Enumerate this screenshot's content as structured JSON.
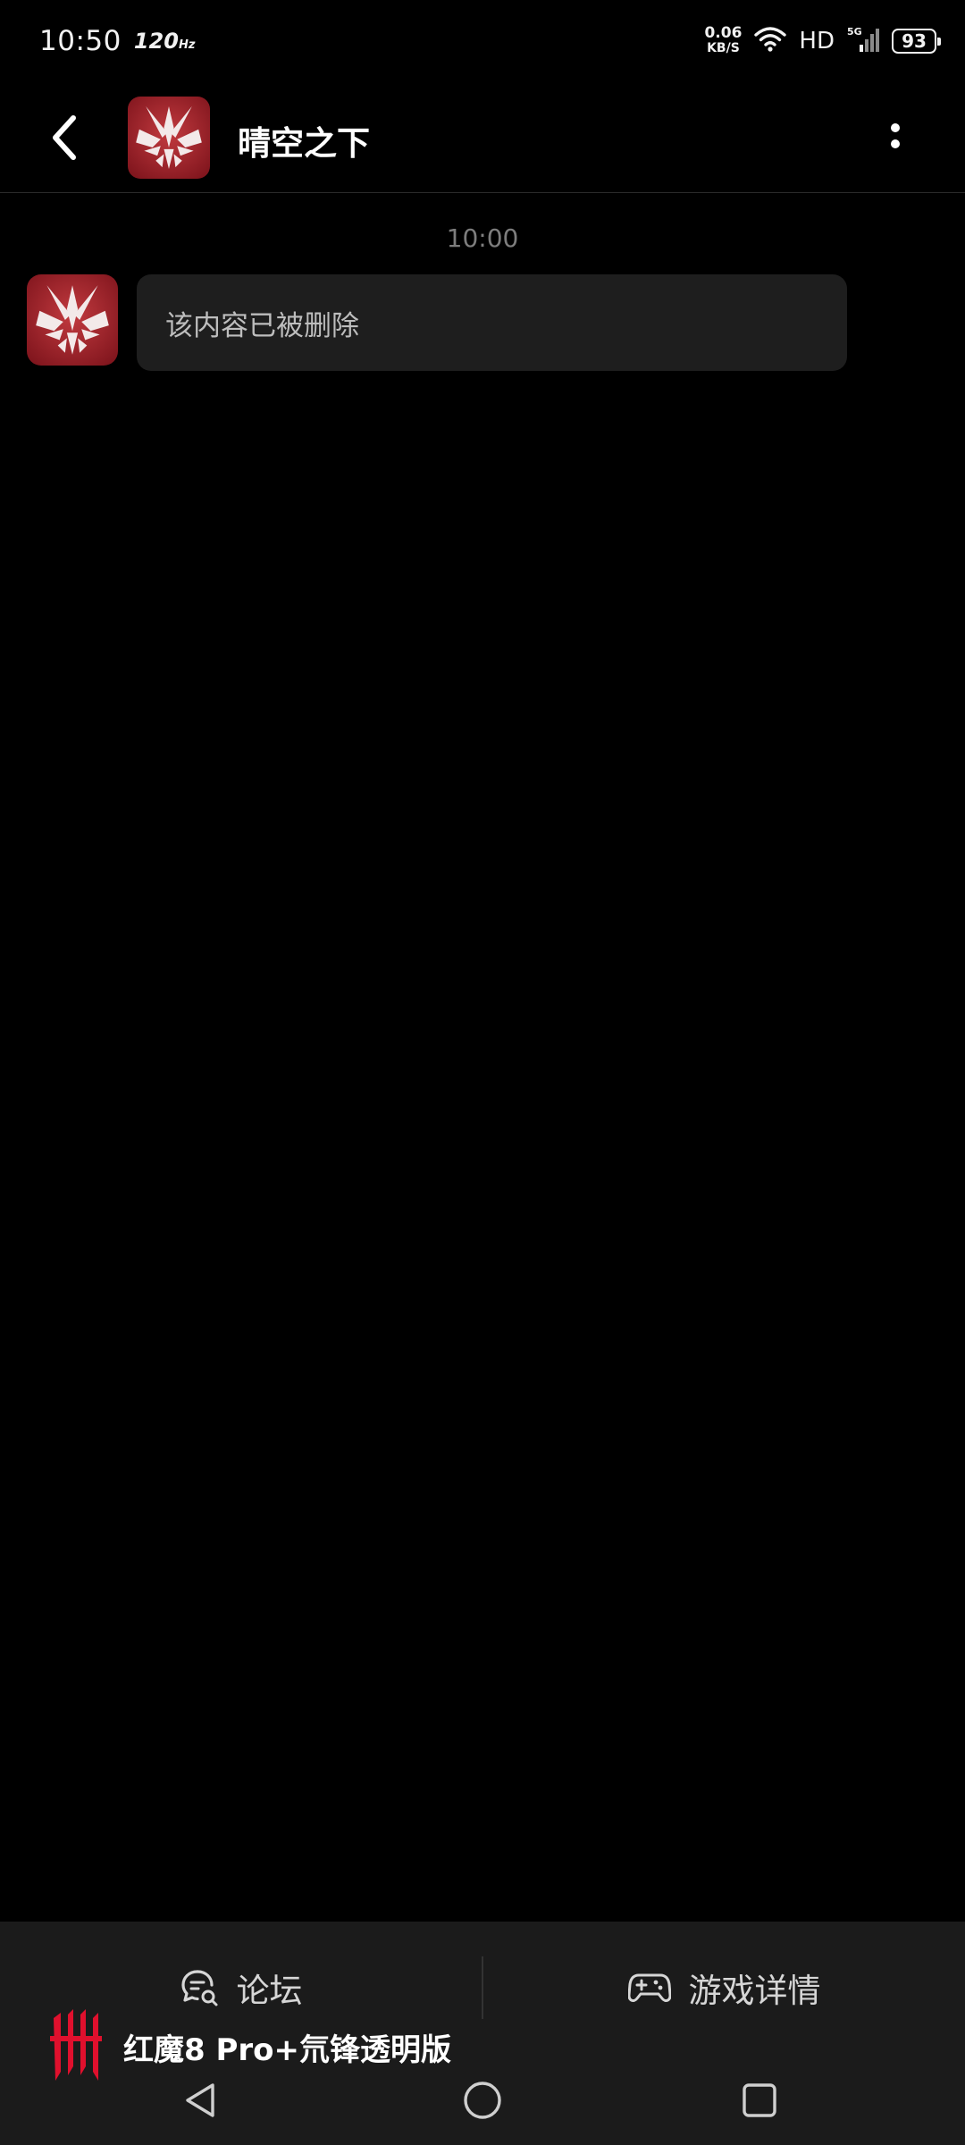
{
  "status_bar": {
    "time": "10:50",
    "refresh_rate": "120",
    "refresh_unit": "Hz",
    "net_speed": "0.06",
    "net_unit": "KB/S",
    "network_type": "HD",
    "signal_label": "5G",
    "battery": "93",
    "icons": [
      "wifi-icon",
      "cell-signal-icon",
      "battery-icon"
    ]
  },
  "header": {
    "title": "晴空之下",
    "icons": [
      "back-arrow-icon",
      "more-vertical-icon"
    ]
  },
  "chat": {
    "timestamp": "10:00",
    "messages": [
      {
        "text": "该内容已被删除"
      }
    ]
  },
  "action_bar": {
    "forum_label": "论坛",
    "game_details_label": "游戏详情",
    "icons": [
      "forum-chat-icon",
      "gamepad-icon"
    ]
  },
  "navigation": {
    "icons": [
      "nav-back-icon",
      "nav-home-icon",
      "nav-recents-icon"
    ]
  },
  "watermark": {
    "device_name": "红魔8 Pro+氘锋透明版"
  },
  "colors": {
    "background": "#000000",
    "bubble": "#1e1e1e",
    "bar": "#1b1b1b",
    "avatar_red": "#a3222c",
    "brand_red": "#e0102d"
  }
}
